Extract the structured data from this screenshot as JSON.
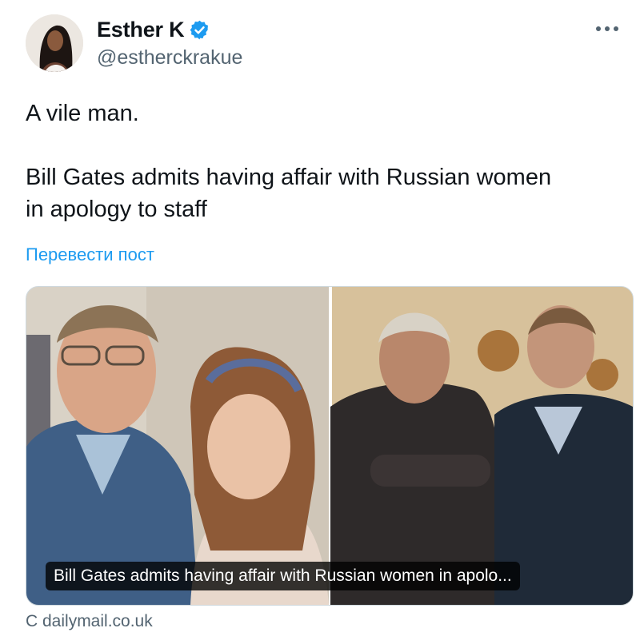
{
  "author": {
    "name": "Esther K",
    "handle": "@estherckrakue",
    "verified": true
  },
  "tweet": {
    "text": "A vile man.\n\nBill Gates admits having affair with Russian women\nin apology to staff",
    "translate_label": "Перевести пост"
  },
  "link_card": {
    "caption": "Bill Gates admits having affair with Russian women in apolo...",
    "source": "C dailymail.co.uk"
  },
  "colors": {
    "accent": "#1d9bf0",
    "secondary_text": "#536471"
  }
}
